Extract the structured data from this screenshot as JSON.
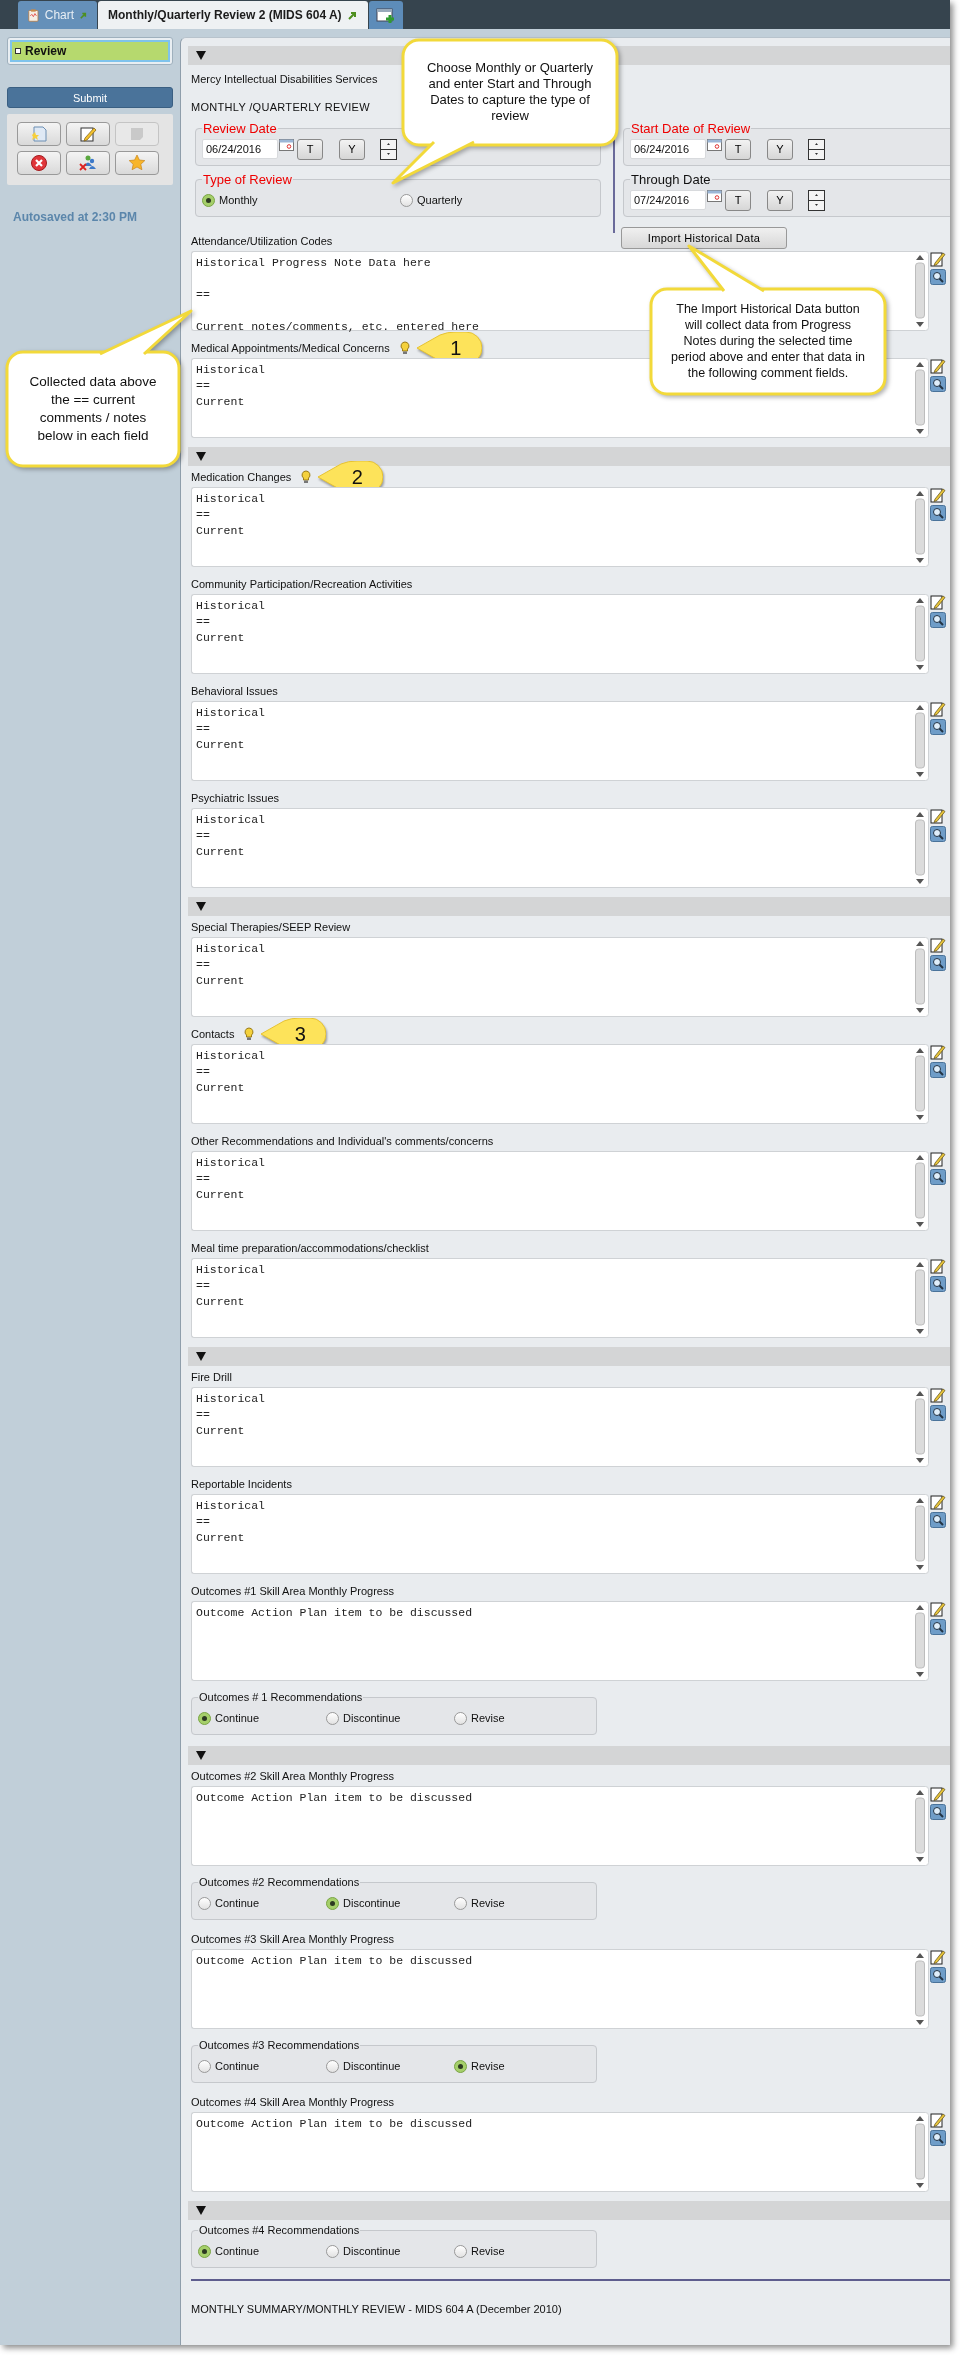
{
  "tabs": [
    {
      "label": "Chart",
      "kind": "chart",
      "selected": false
    },
    {
      "label": "Monthly/Quarterly Review 2 (MIDS 604 A)",
      "kind": "form",
      "selected": true
    }
  ],
  "sidebar": {
    "nav": [
      {
        "label": "Review",
        "selected": true
      }
    ],
    "submit": "Submit",
    "toolbar": [
      {
        "kind": "note",
        "disabled": false
      },
      {
        "kind": "edit",
        "disabled": false
      },
      {
        "kind": "sticky",
        "disabled": true
      },
      {
        "kind": "cancel",
        "disabled": false
      },
      {
        "kind": "users",
        "disabled": false
      },
      {
        "kind": "star",
        "disabled": false
      }
    ],
    "autosave": "Autosaved at 2:30 PM"
  },
  "form": {
    "organization": "Mercy Intellectual Disabilities Services",
    "title": "MONTHLY /QUARTERLY REVIEW",
    "review_date": {
      "legend": "Review Date",
      "required": true,
      "value": "06/24/2016",
      "today_button": "T",
      "yesterday_button": "Y"
    },
    "review_type": {
      "legend": "Type of Review",
      "required": true,
      "options": [
        {
          "label": "Monthly",
          "selected": true
        },
        {
          "label": "Quarterly",
          "selected": false
        }
      ]
    },
    "start_date": {
      "legend": "Start Date of Review",
      "required": true,
      "value": "06/24/2016",
      "today_button": "T",
      "yesterday_button": "Y"
    },
    "through_date": {
      "legend": "Through Date",
      "required": false,
      "value": "07/24/2016",
      "today_button": "T",
      "yesterday_button": "Y"
    },
    "import_button": "Import Historical Data",
    "sections": [
      {
        "fields": [
          {
            "kind": "comment",
            "label": "Attendance/Utilization Codes",
            "value": "Historical Progress Note Data here\n\n==\n\nCurrent notes/comments, etc. entered here"
          },
          {
            "kind": "comment",
            "label": "Medical Appointments/Medical Concerns",
            "value": "Historical\n==\nCurrent",
            "hint": true,
            "badge": "1"
          }
        ]
      },
      {
        "fields": [
          {
            "kind": "comment",
            "label": "Medication Changes",
            "value": "Historical\n==\nCurrent",
            "hint": true,
            "badge": "2"
          },
          {
            "kind": "comment",
            "label": "Community Participation/Recreation Activities",
            "value": "Historical\n==\nCurrent"
          },
          {
            "kind": "comment",
            "label": "Behavioral Issues",
            "value": "Historical\n==\nCurrent"
          },
          {
            "kind": "comment",
            "label": "Psychiatric Issues",
            "value": "Historical\n==\nCurrent"
          }
        ]
      },
      {
        "fields": [
          {
            "kind": "comment",
            "label": "Special Therapies/SEEP Review",
            "value": "Historical\n==\nCurrent"
          },
          {
            "kind": "comment",
            "label": "Contacts",
            "value": "Historical\n==\nCurrent",
            "hint": true,
            "badge": "3"
          },
          {
            "kind": "comment",
            "label": "Other Recommendations and Individual's comments/concerns",
            "value": "Historical\n==\nCurrent"
          },
          {
            "kind": "comment",
            "label": "Meal time preparation/accommodations/checklist",
            "value": "Historical\n==\nCurrent"
          }
        ]
      },
      {
        "fields": [
          {
            "kind": "comment",
            "label": "Fire Drill",
            "value": "Historical\n==\nCurrent"
          },
          {
            "kind": "comment",
            "label": "Reportable Incidents",
            "value": "Historical\n==\nCurrent"
          },
          {
            "kind": "comment",
            "label": "Outcomes #1 Skill Area Monthly Progress",
            "value": "Outcome Action Plan item to be discussed"
          },
          {
            "kind": "choice",
            "legend": "Outcomes # 1 Recommendations",
            "options": [
              {
                "label": "Continue",
                "selected": true
              },
              {
                "label": "Discontinue",
                "selected": false
              },
              {
                "label": "Revise",
                "selected": false
              }
            ]
          }
        ]
      },
      {
        "fields": [
          {
            "kind": "comment",
            "label": "Outcomes #2 Skill Area Monthly Progress",
            "value": "Outcome Action Plan item to be discussed"
          },
          {
            "kind": "choice",
            "legend": "Outcomes #2 Recommendations",
            "options": [
              {
                "label": "Continue",
                "selected": false
              },
              {
                "label": "Discontinue",
                "selected": true
              },
              {
                "label": "Revise",
                "selected": false
              }
            ]
          },
          {
            "kind": "comment",
            "label": "Outcomes #3 Skill Area Monthly Progress",
            "value": "Outcome Action Plan item to be discussed"
          },
          {
            "kind": "choice",
            "legend": "Outcomes #3 Recommendations",
            "options": [
              {
                "label": "Continue",
                "selected": false
              },
              {
                "label": "Discontinue",
                "selected": false
              },
              {
                "label": "Revise",
                "selected": true
              }
            ]
          },
          {
            "kind": "comment",
            "label": "Outcomes #4 Skill Area Monthly Progress",
            "value": "Outcome Action Plan item to be discussed"
          }
        ]
      },
      {
        "fields": [
          {
            "kind": "choice",
            "legend": "Outcomes #4 Recommendations",
            "options": [
              {
                "label": "Continue",
                "selected": true
              },
              {
                "label": "Discontinue",
                "selected": false
              },
              {
                "label": "Revise",
                "selected": false
              }
            ]
          }
        ]
      }
    ],
    "footer": "MONTHLY SUMMARY/MONTHLY REVIEW  - MIDS 604 A (December 2010)"
  },
  "callouts": [
    {
      "text": "Choose Monthly or Quarterly and enter Start and Through Dates to capture the type of review"
    },
    {
      "text": "The Import Historical Data button will collect data from Progress Notes during the selected time period above and enter that data in the following comment fields."
    },
    {
      "text": "Collected data above the == current comments / notes below in each field"
    }
  ]
}
